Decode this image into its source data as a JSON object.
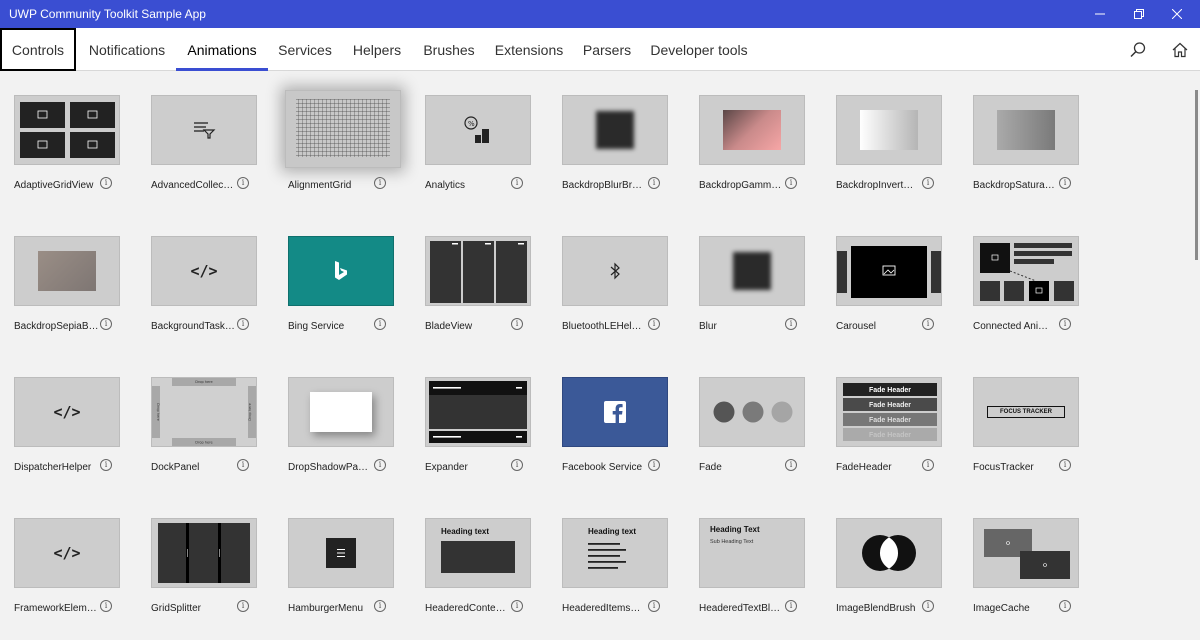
{
  "app": {
    "title": "UWP Community Toolkit Sample App"
  },
  "nav": {
    "tabs": [
      {
        "label": "Controls"
      },
      {
        "label": "Notifications"
      },
      {
        "label": "Animations"
      },
      {
        "label": "Services"
      },
      {
        "label": "Helpers"
      },
      {
        "label": "Brushes"
      },
      {
        "label": "Extensions"
      },
      {
        "label": "Parsers"
      },
      {
        "label": "Developer tools"
      }
    ],
    "active_tab": "Animations",
    "focused_tab": "Controls"
  },
  "samples": [
    {
      "label": "AdaptiveGridView",
      "icon": "grid-images-icon"
    },
    {
      "label": "AdvancedCollec…",
      "icon": "filter-icon"
    },
    {
      "label": "AlignmentGrid",
      "icon": "grid-pattern-icon"
    },
    {
      "label": "Analytics",
      "icon": "analytics-icon"
    },
    {
      "label": "BackdropBlurBr…",
      "icon": "blur-square-icon"
    },
    {
      "label": "BackdropGamm…",
      "icon": "gamma-gradient-icon"
    },
    {
      "label": "BackdropInvert…",
      "icon": "invert-gradient-icon"
    },
    {
      "label": "BackdropSatura…",
      "icon": "saturation-gradient-icon"
    },
    {
      "label": "BackdropSepiaB…",
      "icon": "sepia-rect-icon"
    },
    {
      "label": "BackgroundTask…",
      "icon": "code-icon"
    },
    {
      "label": "Bing Service",
      "icon": "bing-logo-icon"
    },
    {
      "label": "BladeView",
      "icon": "blades-icon"
    },
    {
      "label": "BluetoothLEHel…",
      "icon": "bluetooth-icon"
    },
    {
      "label": "Blur",
      "icon": "blur-square-icon"
    },
    {
      "label": "Carousel",
      "icon": "carousel-icon"
    },
    {
      "label": "Connected Ani…",
      "icon": "connected-animation-icon"
    },
    {
      "label": "DispatcherHelper",
      "icon": "code-icon"
    },
    {
      "label": "DockPanel",
      "icon": "dockpanel-icon"
    },
    {
      "label": "DropShadowPa…",
      "icon": "dropshadow-icon"
    },
    {
      "label": "Expander",
      "icon": "expander-icon"
    },
    {
      "label": "Facebook Service",
      "icon": "facebook-logo-icon"
    },
    {
      "label": "Fade",
      "icon": "fade-circles-icon"
    },
    {
      "label": "FadeHeader",
      "icon": "fade-header-icon"
    },
    {
      "label": "FocusTracker",
      "icon": "focus-tracker-icon"
    },
    {
      "label": "FrameworkElem…",
      "icon": "code-icon"
    },
    {
      "label": "GridSplitter",
      "icon": "gridsplitter-icon"
    },
    {
      "label": "HamburgerMenu",
      "icon": "hamburger-icon"
    },
    {
      "label": "HeaderedConte…",
      "icon": "headered-content-icon"
    },
    {
      "label": "HeaderedItems…",
      "icon": "headered-items-icon"
    },
    {
      "label": "HeaderedTextBl…",
      "icon": "headered-text-icon"
    },
    {
      "label": "ImageBlendBrush",
      "icon": "image-blend-icon"
    },
    {
      "label": "ImageCache",
      "icon": "image-cache-icon"
    }
  ],
  "thumb_text": {
    "dock_drop": "Drop here",
    "fade_header": "Fade Header",
    "focus_tracker": "FOCUS TRACKER",
    "heading_text": "Heading text",
    "heading_text_caps": "Heading Text",
    "sub_heading_text": "Sub Heading Text"
  },
  "info_glyph": "i",
  "colors": {
    "accent": "#3a4ed2",
    "bing": "#138a86",
    "facebook": "#3b5998"
  }
}
